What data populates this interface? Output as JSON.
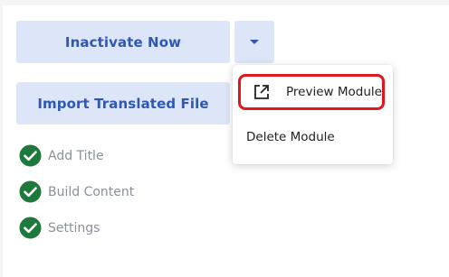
{
  "actions": {
    "inactivate_label": "Inactivate Now",
    "import_label": "Import Translated File"
  },
  "menu": {
    "items": [
      {
        "label": "Preview Module",
        "icon": "external-link-icon",
        "highlighted": true
      },
      {
        "label": "Delete Module"
      }
    ]
  },
  "steps": [
    {
      "label": "Add Title",
      "status": "complete"
    },
    {
      "label": "Build Content",
      "status": "complete"
    },
    {
      "label": "Settings",
      "status": "complete"
    }
  ],
  "colors": {
    "button_bg": "#dde6f8",
    "button_text": "#2f57b3",
    "check_green": "#1e7a3c",
    "highlight_red": "#e0161f"
  }
}
